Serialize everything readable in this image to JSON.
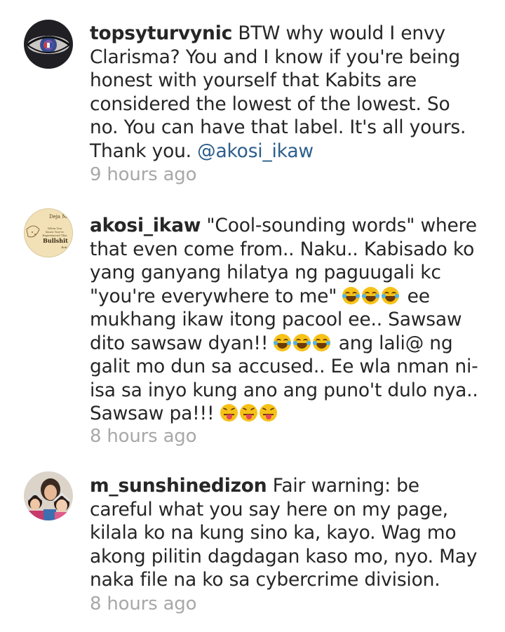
{
  "comments": [
    {
      "username": "topsyturvynic",
      "text": " BTW why would I envy Clarisma? You and I know if you're being honest with yourself that Kabits are considered the lowest of the lowest. So no. You can have that label. It's all yours. Thank you. ",
      "mention": "@akosi_ikaw",
      "time": "9 hours ago",
      "avatar": "eye-avatar"
    },
    {
      "username": "akosi_ikaw",
      "segments": [
        " \"Cool-sounding words\" where that even come from.. Naku.. Kabisado ko yang ganyang hilatya ng paguugali kc \"you're everywhere to me\" ",
        " ee mukhang ikaw itong pacool ee.. Sawsaw dito sawsaw dyan!! ",
        " ang lali@ ng galit mo dun sa accused.. Ee wla nman ni-isa sa inyo kung ano ang puno't dulo nya.. Sawsaw pa!!! "
      ],
      "emoji_names": [
        "face-with-tears-of-joy",
        "face-with-tears-of-joy",
        "squinting-face-with-tongue"
      ],
      "avatar_text": {
        "top": "Deja M",
        "line1": "When You",
        "line2": "Know You've",
        "line3": "Experienced This",
        "big": "Bullshit",
        "bottom": "Befo"
      },
      "time": "8 hours ago"
    },
    {
      "username": "m_sunshinedizon",
      "text": " Fair warning: be careful what you say here on my page, kilala ko na kung sino ka, kayo. Wag mo akong pilitin dagdagan kaso mo, nyo. May naka file na ko sa cybercrime division.",
      "time": "8 hours ago",
      "avatar": "family-photo-avatar"
    }
  ]
}
